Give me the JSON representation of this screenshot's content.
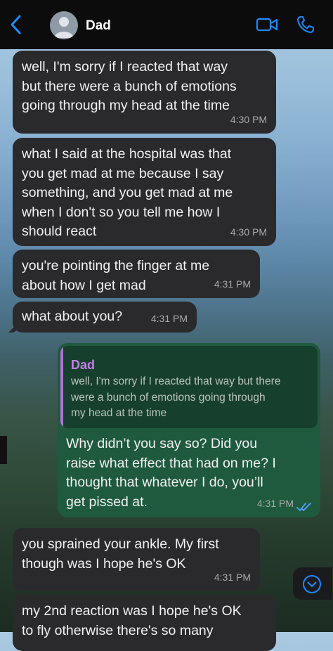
{
  "header": {
    "contact_name": "Dad",
    "icons": [
      "back-chevron-icon",
      "avatar-placeholder-icon",
      "video-camera-icon",
      "phone-icon"
    ],
    "accent_color": "#1a8cff"
  },
  "messages": [
    {
      "direction": "incoming",
      "text": "well, I'm sorry if I reacted that way\nbut there were a bunch of emotions\ngoing through my head at the time",
      "time": "4:30 PM"
    },
    {
      "direction": "incoming",
      "text": "what I said at the hospital was that\nyou get mad at me because I say\nsomething, and you get mad at me\nwhen I don't so you tell me how I\nshould react",
      "time": "4:30 PM"
    },
    {
      "direction": "incoming",
      "text": "you're pointing the finger at me\nabout how I get mad",
      "time": "4:31 PM"
    },
    {
      "direction": "incoming",
      "text": "what about you?",
      "time": "4:31 PM"
    },
    {
      "direction": "outgoing",
      "quote": {
        "author": "Dad",
        "text": "well, I'm sorry if I reacted that way but there\nwere a bunch of emotions going through\nmy head at the time"
      },
      "text": "Why didn’t you say so? Did you\nraise what effect that had on me? I\nthought that whatever I do, you’ll\nget pissed at.",
      "time": "4:31 PM",
      "status": "read"
    },
    {
      "direction": "incoming",
      "text": "you sprained your ankle. My first\nthough was I hope he's OK",
      "time": "4:31 PM"
    },
    {
      "direction": "incoming",
      "text": "my 2nd reaction was I hope he's OK\nto fly otherwise there's so many",
      "time": ""
    }
  ],
  "scroll_down_icon": "chevron-down-circle-icon",
  "colors": {
    "incoming_bubble": "#2a2a2c",
    "outgoing_bubble": "#1f5a3e",
    "quote_author": "#c27fe8",
    "read_ticks": "#4fa3ff"
  }
}
